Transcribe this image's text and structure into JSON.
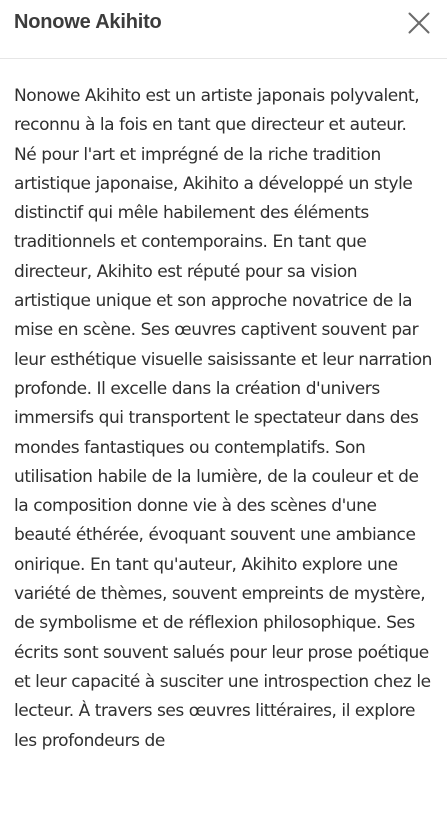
{
  "header": {
    "title": "Nonowe Akihito",
    "close_icon": "close-icon"
  },
  "content": {
    "text": "Nonowe Akihito est un artiste japonais polyvalent, reconnu à la fois en tant que directeur et auteur. Né pour l'art et imprégné de la riche tradition artistique japonaise, Akihito a développé un style distinctif qui mêle habilement des éléments traditionnels et contemporains. En tant que directeur, Akihito est réputé pour sa vision artistique unique et son approche novatrice de la mise en scène. Ses œuvres captivent souvent par leur esthétique visuelle saisissante et leur narration profonde. Il excelle dans la création d'univers immersifs qui transportent le spectateur dans des mondes fantastiques ou contemplatifs. Son utilisation habile de la lumière, de la couleur et de la composition donne vie à des scènes d'une beauté éthérée, évoquant souvent une ambiance onirique. En tant qu'auteur, Akihito explore une variété de thèmes, souvent empreints de mystère, de symbolisme et de réflexion philosophique. Ses écrits sont souvent salués pour leur prose poétique et leur capacité à susciter une introspection chez le lecteur. À travers ses œuvres littéraires, il explore les profondeurs de"
  }
}
